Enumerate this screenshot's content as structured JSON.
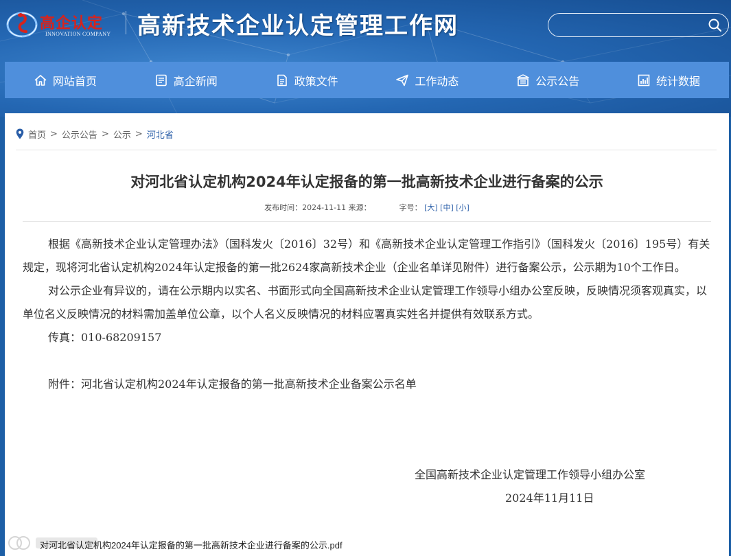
{
  "header": {
    "logo_cn": "高企认定",
    "logo_en": "INNOVATION COMPANY",
    "site_title": "高新技术企业认定管理工作网",
    "search_placeholder": ""
  },
  "nav": [
    {
      "label": "网站首页",
      "icon": "home-icon"
    },
    {
      "label": "高企新闻",
      "icon": "news-icon"
    },
    {
      "label": "政策文件",
      "icon": "document-icon"
    },
    {
      "label": "工作动态",
      "icon": "send-icon"
    },
    {
      "label": "公示公告",
      "icon": "notice-icon"
    },
    {
      "label": "统计数据",
      "icon": "chart-icon"
    }
  ],
  "breadcrumb": {
    "home": "首页",
    "level1": "公示公告",
    "level2": "公示",
    "current": "河北省",
    "separator": ">"
  },
  "article": {
    "title": "对河北省认定机构2024年认定报备的第一批高新技术企业进行备案的公示",
    "publish_label": "发布时间：",
    "publish_date": "2024-11-11",
    "source_label": "来源：",
    "font_size_label": "字号：",
    "font_large": "[大]",
    "font_medium": "[中]",
    "font_small": "[小]",
    "paragraph1": "根据《高新技术企业认定管理办法》（国科发火〔2016〕32号）和《高新技术企业认定管理工作指引》（国科发火〔2016〕195号）有关规定，现将河北省认定机构2024年认定报备的第一批2624家高新技术企业（企业名单详见附件）进行备案公示，公示期为10个工作日。",
    "paragraph2": "对公示企业有异议的，请在公示期内以实名、书面形式向全国高新技术企业认定管理工作领导小组办公室反映，反映情况须客观真实，以单位名义反映情况的材料需加盖单位公章，以个人名义反映情况的材料应署真实姓名并提供有效联系方式。",
    "fax": "传真：010-68209157",
    "attachment_text": "附件：河北省认定机构2024年认定报备的第一批高新技术企业备案公示名单",
    "signature_org": "全国高新技术企业认定管理工作领导小组办公室",
    "signature_date": "2024年11月11日",
    "attachment_link": "对河北省认定机构2024年认定报备的第一批高新技术企业进行备案的公示.pdf"
  },
  "colors": {
    "header_bg": "#2467b3",
    "nav_bg": "#4f8fdc",
    "logo_red": "#d8231c",
    "link_blue": "#2a5ea8"
  }
}
